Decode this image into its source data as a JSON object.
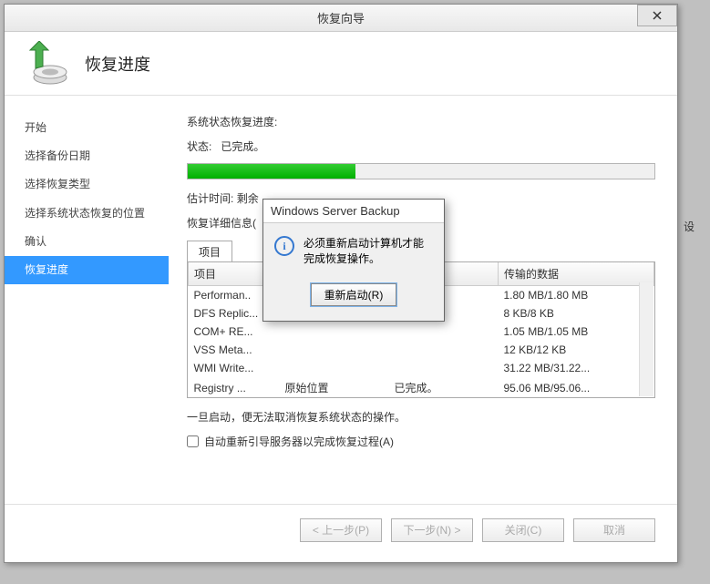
{
  "window": {
    "title": "恢复向导"
  },
  "header": {
    "title": "恢复进度"
  },
  "sidebar": {
    "items": [
      {
        "label": "开始"
      },
      {
        "label": "选择备份日期"
      },
      {
        "label": "选择恢复类型"
      },
      {
        "label": "选择系统状态恢复的位置"
      },
      {
        "label": "确认"
      },
      {
        "label": "恢复进度"
      }
    ],
    "active_index": 5
  },
  "main": {
    "progress_label": "系统状态恢复进度:",
    "status_label": "状态:",
    "status_value": "已完成。",
    "eta_label": "估计时间:",
    "eta_value": "剩余",
    "details_label": "恢复详细信息(",
    "tab_label": "项目",
    "columns": [
      "项目",
      "",
      "",
      "传输的数据"
    ],
    "rows": [
      {
        "item": "Performan..",
        "loc": "",
        "stat": "",
        "data": "1.80 MB/1.80 MB"
      },
      {
        "item": "DFS Replic...",
        "loc": "",
        "stat": "",
        "data": "8 KB/8 KB"
      },
      {
        "item": "COM+ RE...",
        "loc": "",
        "stat": "",
        "data": "1.05 MB/1.05 MB"
      },
      {
        "item": "VSS Meta...",
        "loc": "",
        "stat": "",
        "data": "12 KB/12 KB"
      },
      {
        "item": "WMI Write...",
        "loc": "",
        "stat": "",
        "data": "31.22 MB/31.22..."
      },
      {
        "item": "Registry ...",
        "loc": "原始位置",
        "stat": "已完成。",
        "data": "95.06 MB/95.06..."
      }
    ],
    "note": "一旦启动，便无法取消恢复系统状态的操作。",
    "checkbox_label": "自动重新引导服务器以完成恢复过程(A)"
  },
  "footer": {
    "prev": "< 上一步(P)",
    "next": "下一步(N) >",
    "close": "关闭(C)",
    "cancel": "取消"
  },
  "modal": {
    "title": "Windows Server Backup",
    "message": "必须重新启动计算机才能完成恢复操作。",
    "button": "重新启动(R)"
  },
  "outside": {
    "text": "设"
  }
}
